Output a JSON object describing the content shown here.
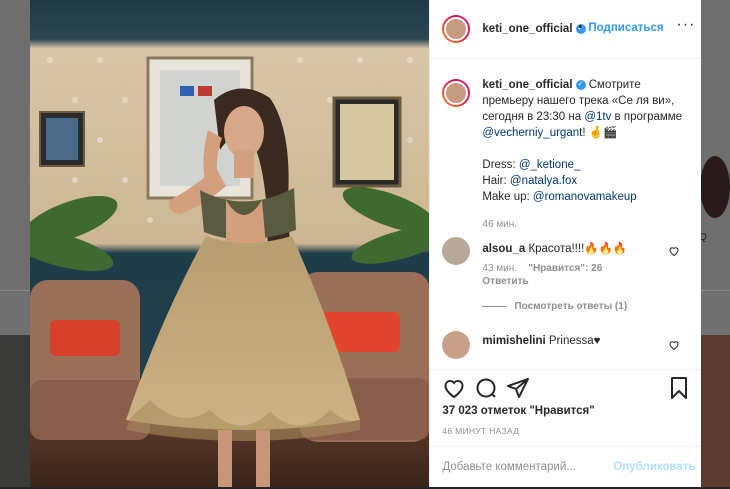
{
  "post": {
    "username": "keti_one_official",
    "follow_label": "Подписаться",
    "more_label": "···",
    "separator": "•"
  },
  "caption": {
    "username": "keti_one_official",
    "text_1": "Смотрите премьеру нашего трека «Се ля ви», сегодня в 23:30 на ",
    "link_1tv": "@1tv",
    "text_2": " в программе ",
    "link_urgant": "@vecherniy_urgant",
    "text_3": "! 🤞🎬",
    "dress_label": "Dress: ",
    "dress_link": "@_ketione_",
    "hair_label": "Hair: ",
    "hair_link": "@natalya.fox",
    "makeup_label": "Make up: ",
    "makeup_link": "@romanovamakeup",
    "time": "46 мин."
  },
  "comments": [
    {
      "username": "alsou_a",
      "text": "Красота!!!!🔥🔥🔥",
      "time": "43 мин.",
      "likes": "\"Нравится\": 26",
      "reply_label": "Ответить"
    },
    {
      "username": "mimishelini",
      "text": "Prinessa♥",
      "time": "",
      "likes": "",
      "reply_label": ""
    }
  ],
  "view_replies": "Посмотреть ответы (1)",
  "actions": {
    "likes_text": "37 023 отметок \"Нравится\"",
    "time_ago": "46 МИНУТ НАЗАД",
    "comment_placeholder": "Добавьте комментарий...",
    "publish_label": "Опубликовать"
  },
  "background": {
    "side_letter": "Q"
  },
  "colors": {
    "link": "#00376b",
    "accent": "#3897f0",
    "publish_disabled": "#b2dffc",
    "muted": "#8e8e8e"
  }
}
